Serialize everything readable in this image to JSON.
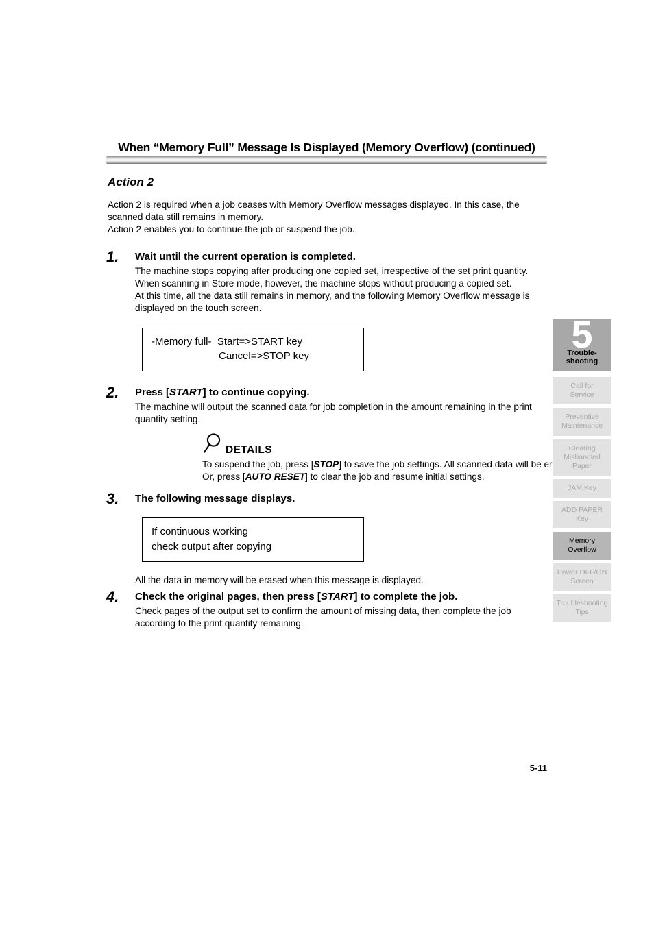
{
  "header": {
    "title": "When “Memory Full” Message Is Displayed (Memory Overflow) (continued)"
  },
  "section": {
    "heading": "Action 2",
    "intro_line1": "Action 2 is required when a job ceases with Memory Overflow messages displayed. In this case, the scanned data still remains in memory.",
    "intro_line2": "Action 2 enables you to continue the job or suspend the job."
  },
  "steps": {
    "one": {
      "number": "1.",
      "title": "Wait until the current operation is completed.",
      "body_p1": "The machine stops copying after producing one copied set, irrespective of the set print quantity. When scanning in Store mode, however, the machine stops without producing a copied set.",
      "body_p2": "At this time, all the data still remains in memory, and the following Memory Overflow message is displayed on the touch screen."
    },
    "two": {
      "number": "2.",
      "title_pre": "Press [",
      "title_key": "START",
      "title_post": "] to continue copying.",
      "body": "The machine will output the scanned data for job completion in the amount remaining in the print quantity setting."
    },
    "three": {
      "number": "3.",
      "title": "The following message displays.",
      "body": "All the data in memory will be erased when this message is displayed."
    },
    "four": {
      "number": "4.",
      "title_pre": "Check the original pages, then press [",
      "title_key": "START",
      "title_post": "] to complete the job.",
      "body": "Check pages of the output set to confirm the amount of missing data, then complete the job according to the print quantity remaining."
    }
  },
  "message_box_1": {
    "line1": "-Memory full-  Start=>START key",
    "line2": "Cancel=>STOP key"
  },
  "message_box_2": {
    "line1": "If continuous working",
    "line2": "check output after copying"
  },
  "details": {
    "icon": "magnifier-icon",
    "label": "DETAILS",
    "line1_pre": "To suspend the job, press [",
    "line1_key": "STOP",
    "line1_post": "] to save the job settings. All scanned data will be erased.",
    "line2_pre": "Or, press [",
    "line2_key": "AUTO RESET",
    "line2_post": "] to clear the job and resume initial settings."
  },
  "tab_rail": {
    "chapter": {
      "number": "5",
      "label_line1": "Trouble-",
      "label_line2": "shooting"
    },
    "items": [
      {
        "line1": "Call for",
        "line2": "Service",
        "line3": "",
        "current": false
      },
      {
        "line1": "Preventive",
        "line2": "Maintenance",
        "line3": "",
        "current": false
      },
      {
        "line1": "Clearing",
        "line2": "Mishandled",
        "line3": "Paper",
        "current": false
      },
      {
        "line1": "JAM Key",
        "line2": "",
        "line3": "",
        "current": false
      },
      {
        "line1": "ADD PAPER",
        "line2": "Key",
        "line3": "",
        "current": false
      },
      {
        "line1": "Memory",
        "line2": "Overflow",
        "line3": "",
        "current": true
      },
      {
        "line1": "Power OFF/ON",
        "line2": "Screen",
        "line3": "",
        "current": false
      },
      {
        "line1": "Troubleshooting",
        "line2": "Tips",
        "line3": "",
        "current": false
      }
    ]
  },
  "footer": {
    "page_number": "5-11"
  },
  "colors": {
    "tab_inactive_bg": "#e2e2e2",
    "tab_inactive_text": "#a9a9a9",
    "tab_current_bg": "#b6b6b6",
    "chapter_tab_bg": "#a8a8a8"
  }
}
